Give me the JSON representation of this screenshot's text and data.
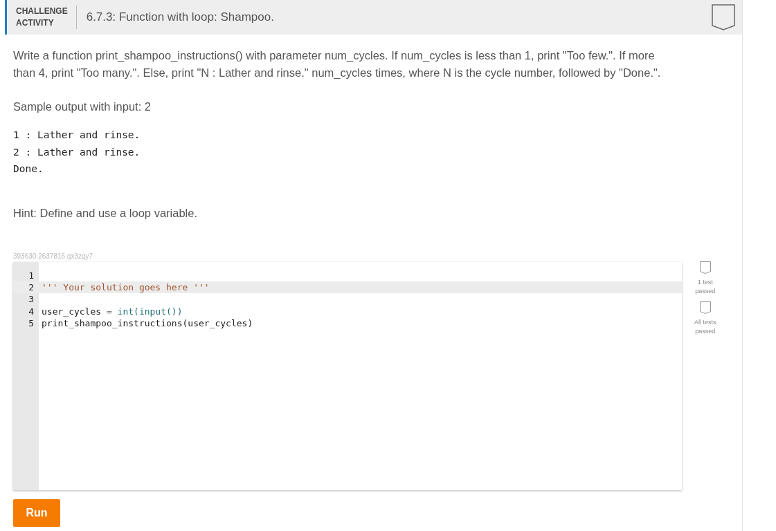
{
  "header": {
    "label_lines": [
      "CHALLENGE",
      "ACTIVITY"
    ],
    "title": "6.7.3: Function with loop: Shampoo.",
    "completed": false
  },
  "description": "Write a function print_shampoo_instructions() with parameter num_cycles. If num_cycles is less than 1, print \"Too few.\". If more than 4, print \"Too many.\". Else, print \"N : Lather and rinse.\" num_cycles times, where N is the cycle number, followed by \"Done.\".",
  "sample_label": "Sample output with input: 2",
  "sample_output": [
    "1 : Lather and rinse.",
    "2 : Lather and rinse.",
    "Done."
  ],
  "hint": "Hint: Define and use a loop variable.",
  "activity_id": "393630.2637816.qx3zqy7",
  "editor": {
    "lines": [
      {
        "number": "1",
        "selected": false
      },
      {
        "number": "2",
        "selected": true,
        "tokens": [
          {
            "kind": "string",
            "text": "''' Your solution goes here '''"
          }
        ]
      },
      {
        "number": "3",
        "selected": false
      },
      {
        "number": "4",
        "selected": false,
        "tokens": [
          {
            "kind": "plain",
            "text": "user_cycles "
          },
          {
            "kind": "operator",
            "text": "="
          },
          {
            "kind": "builtin",
            "text": " int(input())"
          }
        ]
      },
      {
        "number": "5",
        "selected": false,
        "tokens": [
          {
            "kind": "plain",
            "text": "print_shampoo_instructions(user_cycles)"
          }
        ]
      }
    ]
  },
  "test_badges": [
    {
      "label": "1 test passed",
      "passed": false
    },
    {
      "label": "All tests passed",
      "passed": false
    }
  ],
  "run_button": "Run"
}
